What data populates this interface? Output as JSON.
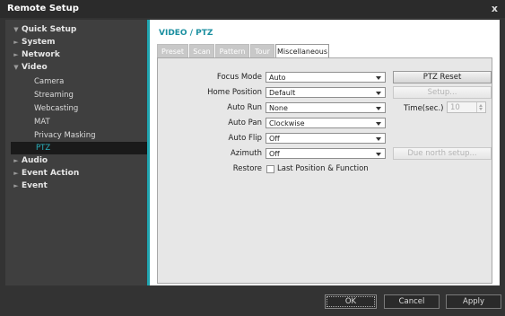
{
  "window": {
    "title": "Remote Setup",
    "close_glyph": "x"
  },
  "sidebar": {
    "items": [
      {
        "label": "Quick Setup",
        "expanded": true
      },
      {
        "label": "System"
      },
      {
        "label": "Network"
      },
      {
        "label": "Video",
        "expanded": true
      },
      {
        "label": "Camera"
      },
      {
        "label": "Streaming"
      },
      {
        "label": "Webcasting"
      },
      {
        "label": "MAT"
      },
      {
        "label": "Privacy Masking"
      },
      {
        "label": "PTZ",
        "selected": true
      },
      {
        "label": "Audio"
      },
      {
        "label": "Event Action"
      },
      {
        "label": "Event"
      }
    ]
  },
  "content": {
    "heading": "VIDEO / PTZ",
    "tabs": [
      {
        "label": "Preset"
      },
      {
        "label": "Scan"
      },
      {
        "label": "Pattern"
      },
      {
        "label": "Tour"
      },
      {
        "label": "Miscellaneous",
        "active": true
      }
    ],
    "fields": {
      "focus_mode": {
        "label": "Focus Mode",
        "value": "Auto"
      },
      "home_position": {
        "label": "Home Position",
        "value": "Default"
      },
      "auto_run": {
        "label": "Auto Run",
        "value": "None"
      },
      "auto_pan": {
        "label": "Auto Pan",
        "value": "Clockwise"
      },
      "auto_flip": {
        "label": "Auto Flip",
        "value": "Off"
      },
      "azimuth": {
        "label": "Azimuth",
        "value": "Off"
      },
      "restore": {
        "label": "Restore",
        "checkbox_label": "Last Position & Function",
        "checked": false
      }
    },
    "buttons": {
      "ptz_reset": "PTZ Reset",
      "setup": "Setup...",
      "due_north": "Due north setup..."
    },
    "time": {
      "label": "Time(sec.)",
      "value": "10"
    }
  },
  "footer": {
    "ok": "OK",
    "cancel": "Cancel",
    "apply": "Apply"
  },
  "colors": {
    "accent": "#1fa5b0",
    "heading": "#1b8fa0",
    "selected_nav_text": "#2ab3bf"
  }
}
